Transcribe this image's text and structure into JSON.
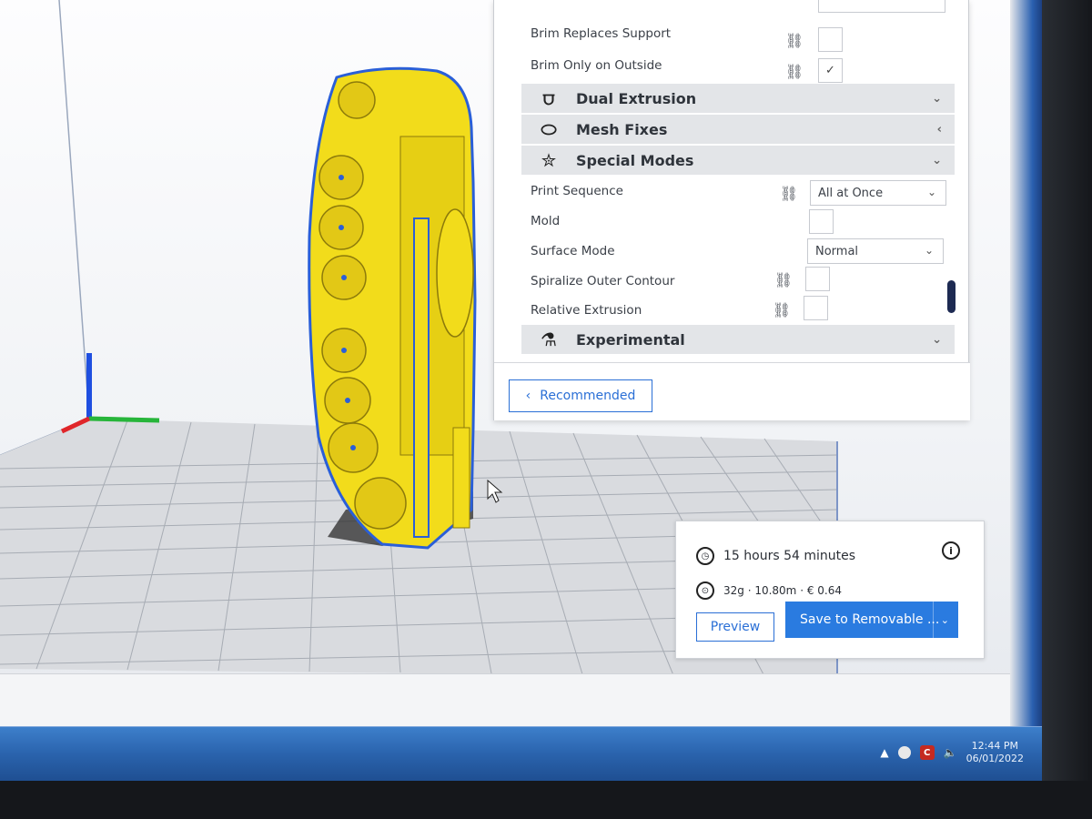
{
  "colors": {
    "accent": "#2a7be0",
    "model_fill": "#f2dc1b",
    "model_outline": "#2a5fd8",
    "taskbar": "#2a63ad"
  },
  "settings_panel": {
    "rows_top": [
      {
        "label": "Brim Replaces Support",
        "checked": false
      },
      {
        "label": "Brim Only on Outside",
        "checked": true
      }
    ],
    "categories_top": [
      {
        "label": "Dual Extrusion",
        "icon": "dual-extrusion-icon",
        "expanded": false
      },
      {
        "label": "Mesh Fixes",
        "icon": "bandage-icon",
        "expanded": false
      },
      {
        "label": "Special Modes",
        "icon": "star-icon",
        "expanded": true
      }
    ],
    "special_modes": {
      "print_sequence": {
        "label": "Print Sequence",
        "value": "All at Once"
      },
      "mold": {
        "label": "Mold",
        "checked": false
      },
      "surface_mode": {
        "label": "Surface Mode",
        "value": "Normal"
      },
      "spiralize": {
        "label": "Spiralize Outer Contour",
        "checked": false
      },
      "relative_extrusion": {
        "label": "Relative Extrusion",
        "checked": false
      }
    },
    "experimental": {
      "label": "Experimental",
      "icon": "flask-icon"
    },
    "recommended_button": "Recommended",
    "check_mark": "✓",
    "chevron_down": "⌄",
    "chevron_left": "‹"
  },
  "estimate": {
    "time": "15 hours 54 minutes",
    "material": "32g · 10.80m · € 0.64",
    "info": "i",
    "preview_button": "Preview",
    "save_button": "Save to Removable ..."
  },
  "taskbar": {
    "time": "12:44 PM",
    "date": "06/01/2022",
    "tray_app_letter": "C"
  }
}
